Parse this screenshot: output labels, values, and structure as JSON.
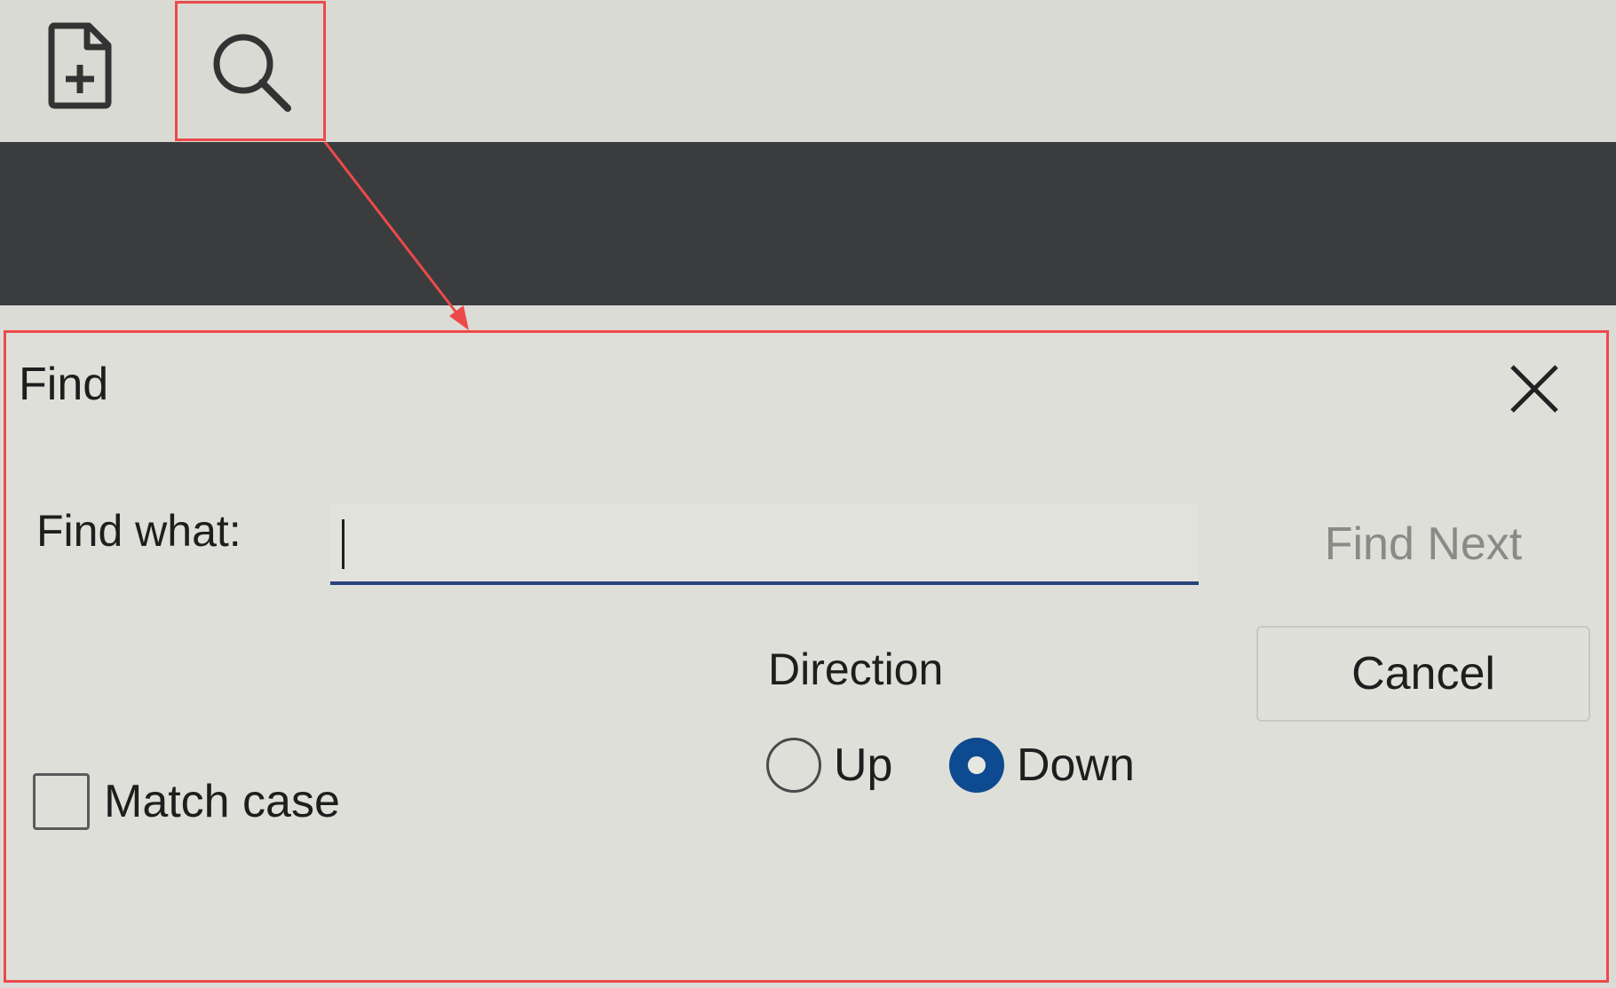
{
  "toolbar": {
    "new_icon": "file-plus-icon",
    "find_icon": "search-icon"
  },
  "dialog": {
    "title": "Find",
    "close_icon": "close-icon",
    "find_what_label": "Find what:",
    "find_what_value": "",
    "find_next_label": "Find Next",
    "cancel_label": "Cancel",
    "direction_label": "Direction",
    "direction_up_label": "Up",
    "direction_down_label": "Down",
    "direction_selected": "Down",
    "match_case_label": "Match case",
    "match_case_checked": false
  },
  "colors": {
    "highlight": "#ec4a4a",
    "accent": "#0e4a8f",
    "input_underline": "#27447e",
    "dark_band": "#3a3c3e"
  }
}
